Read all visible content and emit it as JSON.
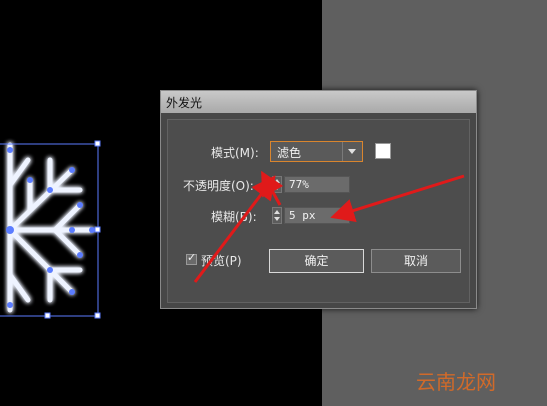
{
  "dialog": {
    "title": "外发光",
    "mode_label": "模式(M):",
    "mode_value": "滤色",
    "swatch_color": "#ffffff",
    "opacity_label": "不透明度(O):",
    "opacity_value": "77%",
    "blur_label": "模糊(B):",
    "blur_value": "5 px",
    "preview_label": "预览(P)",
    "preview_checked": true,
    "ok_label": "确定",
    "cancel_label": "取消"
  },
  "annotations": {
    "arrow_color": "#e01a1a"
  },
  "watermark": {
    "text": "云南龙网"
  }
}
